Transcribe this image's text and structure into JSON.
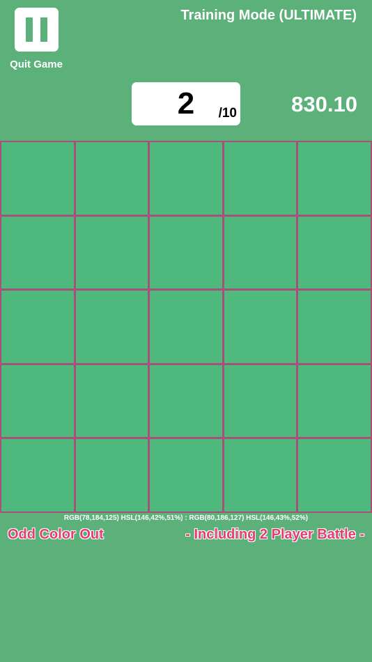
{
  "header": {
    "quit_label": "Quit Game",
    "mode_title": "Training Mode (ULTIMATE)"
  },
  "level": {
    "current": "2",
    "total": "/10"
  },
  "score": "830.10",
  "board": {
    "rows": 5,
    "cols": 5,
    "base_color": "#4eb87d",
    "odd_color": "#50ba7f",
    "odd_index": 13,
    "grid_line_color": "#a8507a"
  },
  "color_info": "RGB(78,184,125) HSL(146,42%,51%) : RGB(80,186,127) HSL(146,43%,52%)",
  "footer": {
    "left_text": "Odd Color Out",
    "right_text": "- Including 2 Player Battle -"
  },
  "colors": {
    "background": "#5cb07a",
    "accent_pink": "#e63c72"
  }
}
